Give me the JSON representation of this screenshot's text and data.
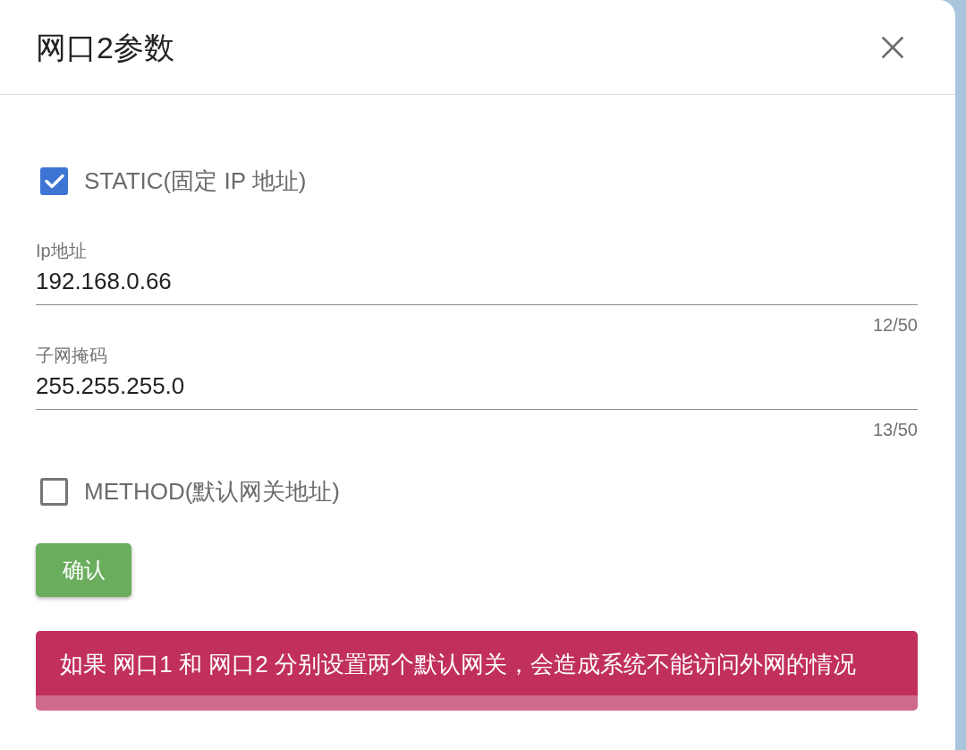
{
  "dialog": {
    "title": "网口2参数"
  },
  "form": [
    {
      "kind": "checkbox",
      "label": "STATIC(固定 IP 地址)",
      "checked": true
    },
    {
      "kind": "text_field",
      "label": "Ip地址",
      "value": "192.168.0.66",
      "counter": "12/50"
    },
    {
      "kind": "text_field",
      "label": "子网掩码",
      "value": "255.255.255.0",
      "counter": "13/50"
    },
    {
      "kind": "checkbox",
      "label": "METHOD(默认网关地址)",
      "checked": false
    }
  ],
  "confirm_button": {
    "label": "确认"
  },
  "alert": {
    "text": "如果 网口1 和 网口2 分别设置两个默认网关，会造成系统不能访问外网的情况"
  }
}
